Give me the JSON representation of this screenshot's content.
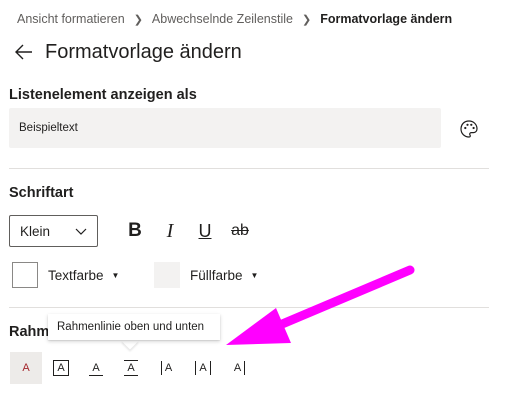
{
  "breadcrumb": {
    "items": [
      "Ansicht formatieren",
      "Abwechselnde Zeilenstile"
    ],
    "current": "Formatvorlage ändern",
    "separator": ">"
  },
  "header": {
    "back_icon": "arrow-left-icon",
    "title": "Formatvorlage ändern"
  },
  "display_section": {
    "label": "Listenelement anzeigen als",
    "value": "Beispieltext",
    "palette_icon": "palette-icon"
  },
  "font_section": {
    "label": "Schriftart",
    "size_value": "Klein",
    "format_buttons": {
      "bold": "B",
      "italic": "I",
      "underline": "U",
      "strikethrough": "ab"
    },
    "text_color_label": "Textfarbe",
    "fill_color_label": "Füllfarbe"
  },
  "border_section": {
    "label": "Rahme",
    "tooltip": "Rahmenlinie oben und unten",
    "options": [
      {
        "glyph": "A",
        "icon": "no-border-icon",
        "selected": true
      },
      {
        "glyph": "A",
        "icon": "box-border-icon",
        "selected": false
      },
      {
        "glyph": "A",
        "icon": "bottom-border-icon",
        "selected": false
      },
      {
        "glyph": "A",
        "icon": "top-bottom-border-icon",
        "selected": false
      },
      {
        "glyph": "A",
        "icon": "left-border-icon",
        "selected": false
      },
      {
        "glyph": "A",
        "icon": "left-right-border-icon",
        "selected": false
      },
      {
        "glyph": "A",
        "icon": "right-border-icon",
        "selected": false
      }
    ]
  },
  "colors": {
    "text": "#201f1e",
    "muted": "#605e5c",
    "field_bg": "#f3f2f1",
    "selected_bg": "#edebe9",
    "selected_glyph": "#a4262c",
    "annotation_arrow": "#ff00ff"
  }
}
